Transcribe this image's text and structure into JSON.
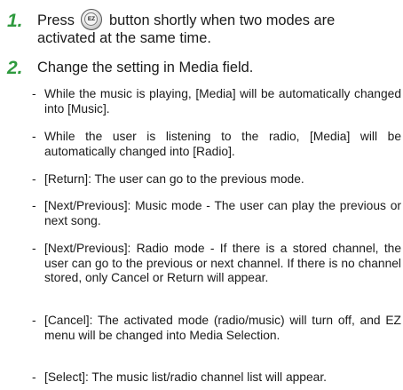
{
  "steps": [
    {
      "number": "1.",
      "text_before": "Press",
      "icon": "ez-button-icon",
      "icon_label": "EZ",
      "text_after": "button shortly when two modes are",
      "line2": "activated at the same time."
    },
    {
      "number": "2.",
      "text": "Change the setting in Media field."
    }
  ],
  "bullets": [
    {
      "dash": "-",
      "text": "While the music is playing, [Media] will be automatically changed into [Music]."
    },
    {
      "dash": "-",
      "text": "While the user is listening to the radio, [Media] will be automatically changed into [Radio]."
    },
    {
      "dash": "-",
      "text": "[Return]: The user can go to the previous mode."
    },
    {
      "dash": "-",
      "text": "[Next/Previous]: Music mode - The user can play the previous or next song."
    },
    {
      "dash": "-",
      "text": "[Next/Previous]: Radio mode - If there is a stored channel, the user can go to the previous or next channel. If there is no channel stored, only Cancel or Return will appear."
    },
    {
      "dash": "-",
      "text": "[Cancel]: The activated mode (radio/music) will turn off, and EZ menu will be changed into Media Selection."
    },
    {
      "dash": "-",
      "text": "[Select]: The music list/radio channel list will appear."
    }
  ]
}
